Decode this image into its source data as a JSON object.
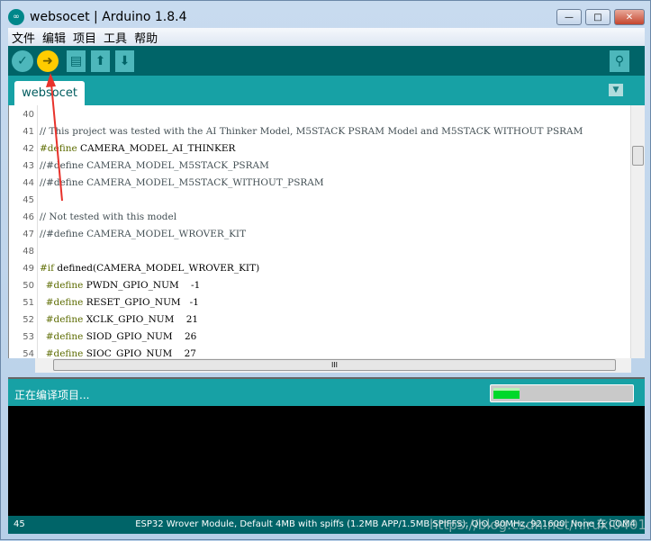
{
  "window": {
    "title": "websocet | Arduino 1.8.4",
    "minimize": "—",
    "maximize": "□",
    "close": "✕"
  },
  "menu": [
    "文件",
    "编辑",
    "项目",
    "工具",
    "帮助"
  ],
  "toolbar": {
    "verify": "✓",
    "upload": "➜",
    "new": "▤",
    "open": "⬆",
    "save": "⬇",
    "serial_monitor": "⚲"
  },
  "tab": {
    "label": "websocet",
    "menu": "▼"
  },
  "editor": {
    "lines": [
      {
        "n": "40",
        "code": ""
      },
      {
        "n": "41",
        "code": "// This project was tested with the AI Thinker Model, M5STACK PSRAM Model and M5STACK WITHOUT PSRAM"
      },
      {
        "n": "42",
        "code": "#define CAMERA_MODEL_AI_THINKER"
      },
      {
        "n": "43",
        "code": "//#define CAMERA_MODEL_M5STACK_PSRAM"
      },
      {
        "n": "44",
        "code": "//#define CAMERA_MODEL_M5STACK_WITHOUT_PSRAM"
      },
      {
        "n": "45",
        "code": ""
      },
      {
        "n": "46",
        "code": "// Not tested with this model"
      },
      {
        "n": "47",
        "code": "//#define CAMERA_MODEL_WROVER_KIT"
      },
      {
        "n": "48",
        "code": ""
      },
      {
        "n": "49",
        "code": "#if defined(CAMERA_MODEL_WROVER_KIT)"
      },
      {
        "n": "50",
        "code": "  #define PWDN_GPIO_NUM    -1"
      },
      {
        "n": "51",
        "code": "  #define RESET_GPIO_NUM   -1"
      },
      {
        "n": "52",
        "code": "  #define XCLK_GPIO_NUM    21"
      },
      {
        "n": "53",
        "code": "  #define SIOD_GPIO_NUM    26"
      },
      {
        "n": "54",
        "code": "  #define SIOC_GPIO_NUM    27"
      }
    ],
    "hscroll_grip": "III"
  },
  "status": {
    "message": "正在编译项目...",
    "progress_percent": 19,
    "progress_color": "#00d82a"
  },
  "bottombar": {
    "line": "45",
    "board": "ESP32 Wrover Module, Default 4MB with spiffs (1.2MB APP/1.5MB SPIFFS), QIO, 80MHz, 921600, None 在 COM4"
  },
  "watermark": "https://blog.csdn.net/niruxi0401",
  "colors": {
    "toolbar": "#006468",
    "tabstrip": "#17a1a5",
    "upload_button": "#ffcc00",
    "annotation_arrow": "#e8322b"
  }
}
